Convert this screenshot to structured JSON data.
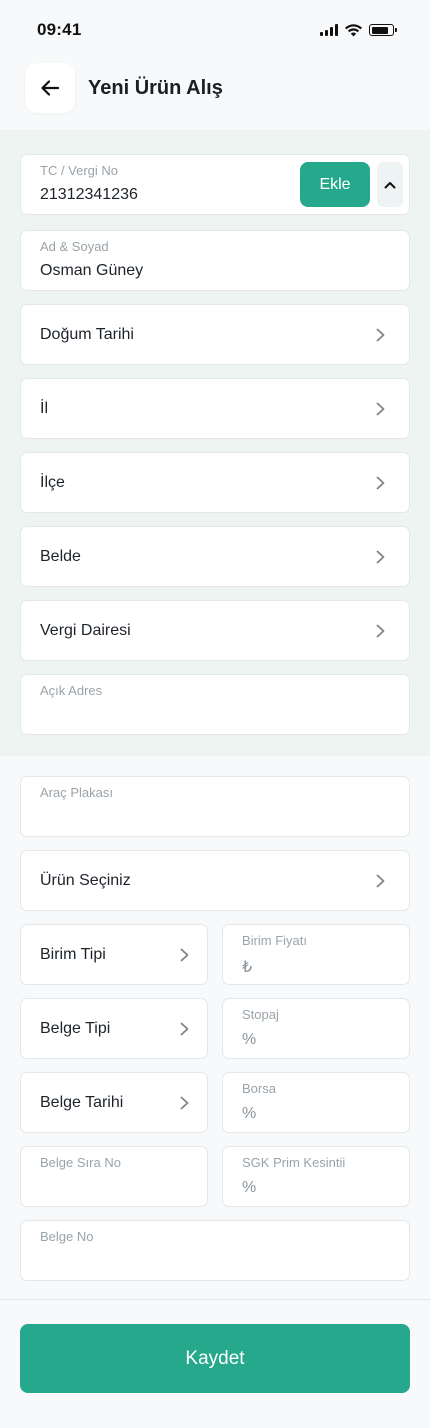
{
  "status_bar": {
    "time": "09:41"
  },
  "header": {
    "title": "Yeni Ürün Alış",
    "back_icon": "arrow-left-icon"
  },
  "customer": {
    "tc": {
      "label": "TC / Vergi No",
      "value": "21312341236"
    },
    "add_button_label": "Ekle",
    "name": {
      "label": "Ad & Soyad",
      "value": "Osman Güney"
    },
    "birth_date_label": "Doğum Tarihi",
    "province_label": "İl",
    "district_label": "İlçe",
    "town_label": "Belde",
    "tax_office_label": "Vergi Dairesi",
    "address": {
      "label": "Açık Adres",
      "value": ""
    }
  },
  "purchase": {
    "plate": {
      "label": "Araç Plakası",
      "value": ""
    },
    "product_label": "Ürün Seçiniz",
    "unit_type_label": "Birim Tipi",
    "unit_price": {
      "label": "Birim Fiyatı",
      "placeholder": "₺"
    },
    "doc_type_label": "Belge Tipi",
    "withholding": {
      "label": "Stopaj",
      "placeholder": "%"
    },
    "doc_date_label": "Belge Tarihi",
    "exchange": {
      "label": "Borsa",
      "placeholder": "%"
    },
    "doc_seq": {
      "label": "Belge Sıra No",
      "value": ""
    },
    "sgk": {
      "label": "SGK Prim Kesintii",
      "placeholder": "%"
    },
    "doc_no": {
      "label": "Belge No",
      "value": ""
    }
  },
  "footer": {
    "save_label": "Kaydet"
  },
  "colors": {
    "accent": "#25a88b",
    "section_bg": "#eef4f2",
    "page_bg": "#f7f9fa"
  }
}
